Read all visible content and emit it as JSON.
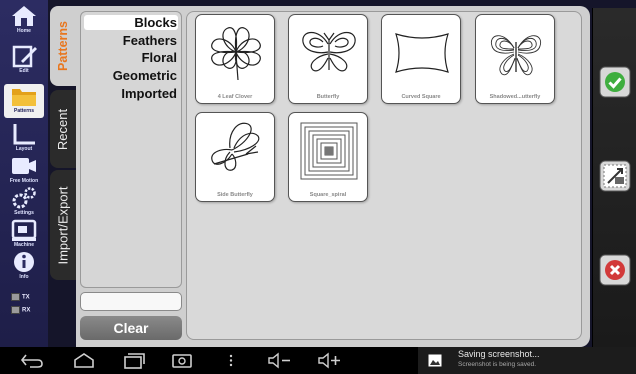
{
  "nav": {
    "items": [
      {
        "label": "Home",
        "icon": "home-icon"
      },
      {
        "label": "Edit",
        "icon": "edit-icon"
      },
      {
        "label": "Patterns",
        "icon": "patterns-folder-icon"
      },
      {
        "label": "Layout",
        "icon": "layout-icon"
      },
      {
        "label": "Free Motion",
        "icon": "free-motion-icon"
      },
      {
        "label": "Settings",
        "icon": "settings-icon"
      },
      {
        "label": "Machine",
        "icon": "machine-icon"
      },
      {
        "label": "Info",
        "icon": "info-icon"
      }
    ],
    "tx_label": "TX",
    "rx_label": "RX"
  },
  "tabs": {
    "patterns": "Patterns",
    "recent": "Recent",
    "import_export": "Import/Export"
  },
  "categories": [
    "Blocks",
    "Feathers",
    "Floral",
    "Geometric",
    "Imported"
  ],
  "search": {
    "value": ""
  },
  "clear_label": "Clear",
  "patterns": [
    {
      "name": "4 Leaf Clover",
      "icon": "clover-pattern"
    },
    {
      "name": "Butterfly",
      "icon": "butterfly-pattern"
    },
    {
      "name": "Curved Square",
      "icon": "curved-square-pattern"
    },
    {
      "name": "Shadowed...utterfly",
      "icon": "shadowed-butterfly-pattern"
    },
    {
      "name": "Side Butterfly",
      "icon": "side-butterfly-pattern"
    },
    {
      "name": "Square_spiral",
      "icon": "square-spiral-pattern"
    }
  ],
  "right_actions": [
    {
      "icon": "check-icon"
    },
    {
      "icon": "resize-icon"
    },
    {
      "icon": "cancel-icon"
    }
  ],
  "notification": {
    "title": "Saving screenshot...",
    "subtitle": "Screenshot is being saved."
  },
  "colors": {
    "accent": "#e8761e",
    "nav_bg": "#2c2c62",
    "panel_bg": "#cfcfcf",
    "confirm": "#3fae3f",
    "cancel": "#d23a3a"
  }
}
